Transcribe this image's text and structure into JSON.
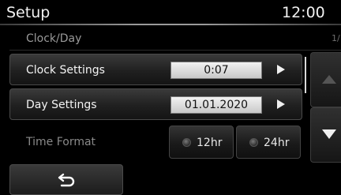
{
  "header": {
    "title": "Setup",
    "clock": "12:00"
  },
  "subheader": {
    "title": "Clock/Day",
    "page_indicator": "1/"
  },
  "rows": {
    "clock_settings": {
      "label": "Clock Settings",
      "value": "0:07"
    },
    "day_settings": {
      "label": "Day Settings",
      "value": "01.01.2020"
    }
  },
  "time_format": {
    "label": "Time Format",
    "options": [
      {
        "label": "12hr",
        "selected": false
      },
      {
        "label": "24hr",
        "selected": false
      }
    ]
  },
  "icons": {
    "row_arrow": "play-right-icon",
    "scroll_up": "triangle-up-icon",
    "scroll_down": "triangle-down-icon",
    "back": "u-turn-back-icon",
    "radio": "radio-button-icon"
  },
  "colors": {
    "background": "#000000",
    "button_gradient_top": "#3a3a3a",
    "value_box": "#e0e0e0",
    "muted_text": "#8a8a8a"
  }
}
